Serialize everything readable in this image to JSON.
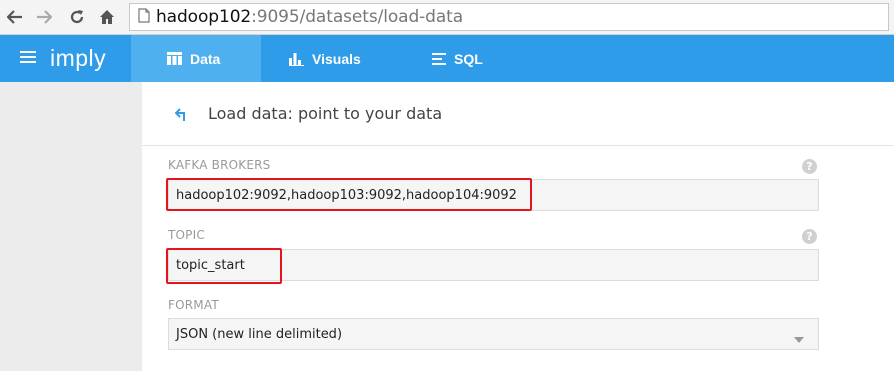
{
  "browser": {
    "url_host": "hadoop102",
    "url_rest": ":9095/datasets/load-data"
  },
  "header": {
    "brand": "imply",
    "tabs": [
      {
        "label": "Data",
        "icon": "table-icon",
        "active": true
      },
      {
        "label": "Visuals",
        "icon": "bar-chart-icon",
        "active": false
      },
      {
        "label": "SQL",
        "icon": "lines-icon",
        "active": false
      }
    ]
  },
  "page": {
    "title": "Load data: point to your data"
  },
  "form": {
    "kafka_brokers": {
      "label": "KAFKA BROKERS",
      "value": "hadoop102:9092,hadoop103:9092,hadoop104:9092"
    },
    "topic": {
      "label": "TOPIC",
      "value": "topic_start"
    },
    "format": {
      "label": "FORMAT",
      "value": "JSON (new line delimited)"
    },
    "help_glyph": "?"
  },
  "colors": {
    "header_bg": "#2e9ce8",
    "active_tab_bg": "#4fb0ef",
    "highlight": "#e3161b"
  }
}
